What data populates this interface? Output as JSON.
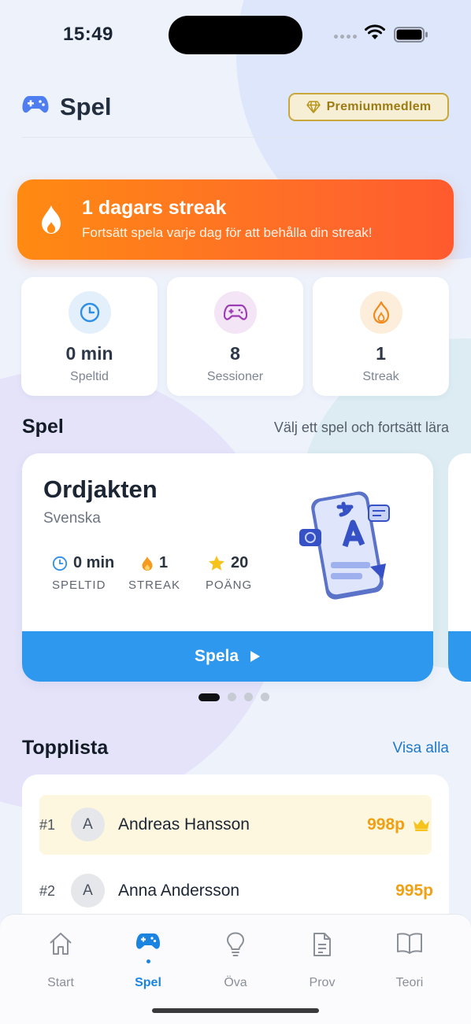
{
  "status_bar": {
    "time": "15:49"
  },
  "header": {
    "title": "Spel",
    "premium_label": "Premiummedlem"
  },
  "streak_banner": {
    "title": "1 dagars streak",
    "subtitle": "Fortsätt spela varje dag för att behålla din streak!"
  },
  "stats": [
    {
      "icon": "clock-icon",
      "value": "0 min",
      "label": "Speltid"
    },
    {
      "icon": "gamepad-icon",
      "value": "8",
      "label": "Sessioner"
    },
    {
      "icon": "flame-icon",
      "value": "1",
      "label": "Streak"
    }
  ],
  "games_section": {
    "title": "Spel",
    "subtitle": "Välj ett spel och fortsätt lära",
    "current_game": {
      "title": "Ordjakten",
      "language": "Svenska",
      "stats": [
        {
          "icon": "clock-icon",
          "value": "0 min",
          "label": "SPELTID"
        },
        {
          "icon": "flame-icon",
          "value": "1",
          "label": "STREAK"
        },
        {
          "icon": "star-icon",
          "value": "20",
          "label": "POÄNG"
        }
      ],
      "play_label": "Spela"
    },
    "pager": {
      "count": 4,
      "active_index": 0
    }
  },
  "leaderboard": {
    "title": "Topplista",
    "view_all_label": "Visa alla",
    "rows": [
      {
        "rank": "#1",
        "initial": "A",
        "name": "Andreas Hansson",
        "points": "998p"
      },
      {
        "rank": "#2",
        "initial": "A",
        "name": "Anna Andersson",
        "points": "995p"
      }
    ]
  },
  "tab_bar": {
    "active": "Spel",
    "tabs": [
      {
        "label": "Start",
        "icon": "home-icon"
      },
      {
        "label": "Spel",
        "icon": "gamepad-icon"
      },
      {
        "label": "Öva",
        "icon": "lightbulb-icon"
      },
      {
        "label": "Prov",
        "icon": "document-icon"
      },
      {
        "label": "Teori",
        "icon": "book-icon"
      }
    ]
  },
  "colors": {
    "accent_blue": "#2e98ee",
    "tab_active": "#1a84e0",
    "streak_orange": "#ff7a1f",
    "points_gold": "#f0a012",
    "premium_gold": "#c9a83a"
  }
}
